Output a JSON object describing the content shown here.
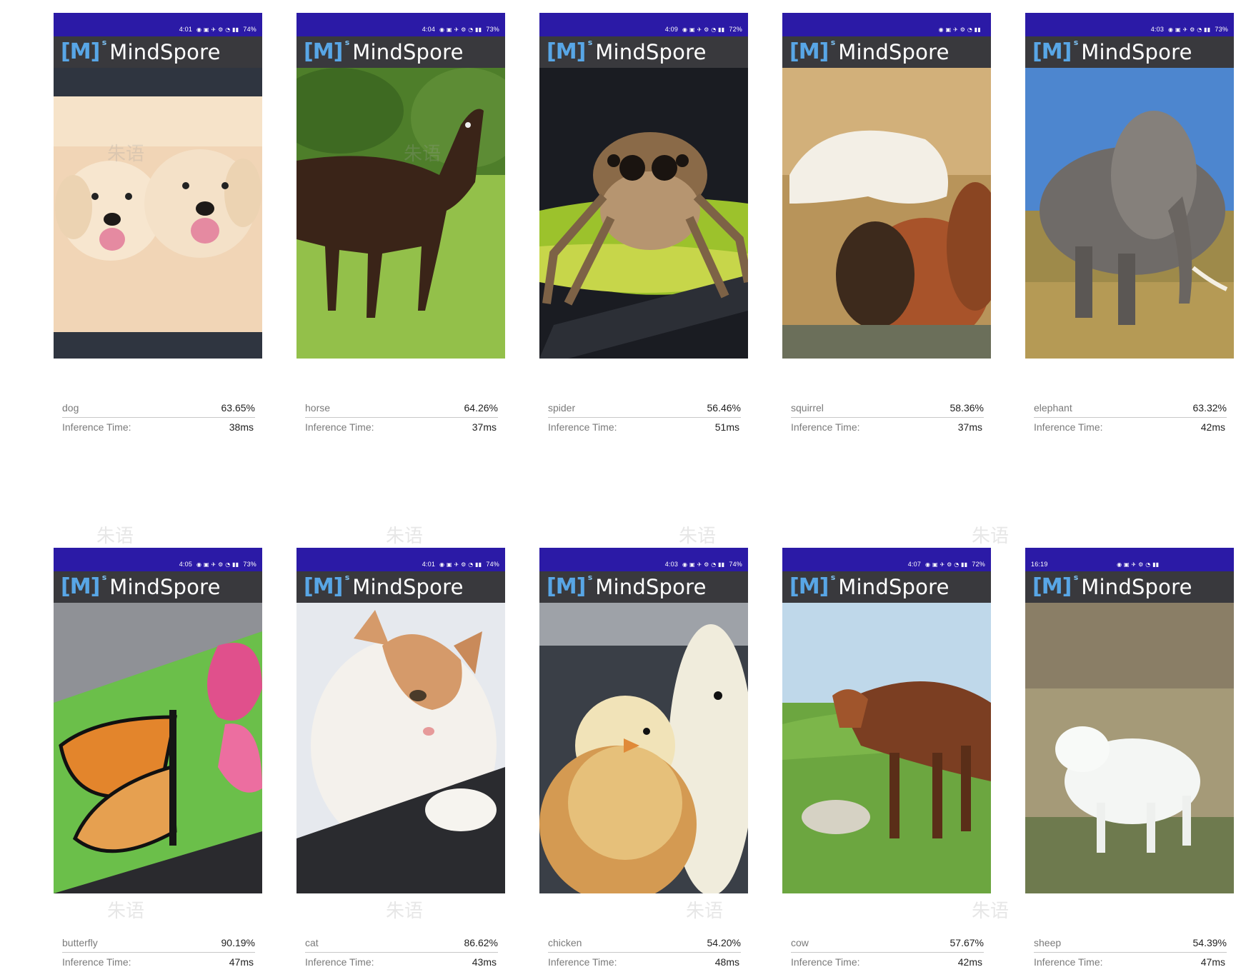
{
  "app": {
    "brand_mark": "[M]",
    "brand_super": "s",
    "name": "MindSpore",
    "inference_label": "Inference Time:"
  },
  "watermark_text": "朱语",
  "screens": [
    {
      "time": "4:01",
      "battery": "74%",
      "label": "dog",
      "confidence": "63.65%",
      "inference_ms": "38ms",
      "subject": "dog"
    },
    {
      "time": "4:04",
      "battery": "73%",
      "label": "horse",
      "confidence": "64.26%",
      "inference_ms": "37ms",
      "subject": "horse"
    },
    {
      "time": "4:09",
      "battery": "72%",
      "label": "spider",
      "confidence": "56.46%",
      "inference_ms": "51ms",
      "subject": "spider"
    },
    {
      "time": "",
      "battery": "",
      "label": "squirrel",
      "confidence": "58.36%",
      "inference_ms": "37ms",
      "subject": "squirrel"
    },
    {
      "time": "4:03",
      "battery": "73%",
      "label": "elephant",
      "confidence": "63.32%",
      "inference_ms": "42ms",
      "subject": "elephant"
    },
    {
      "time": "4:05",
      "battery": "73%",
      "label": "butterfly",
      "confidence": "90.19%",
      "inference_ms": "47ms",
      "subject": "butterfly"
    },
    {
      "time": "4:01",
      "battery": "74%",
      "label": "cat",
      "confidence": "86.62%",
      "inference_ms": "43ms",
      "subject": "cat"
    },
    {
      "time": "4:03",
      "battery": "74%",
      "label": "chicken",
      "confidence": "54.20%",
      "inference_ms": "48ms",
      "subject": "chicken"
    },
    {
      "time": "4:07",
      "battery": "72%",
      "label": "cow",
      "confidence": "57.67%",
      "inference_ms": "42ms",
      "subject": "cow"
    },
    {
      "time": "16:19",
      "battery": "",
      "label": "sheep",
      "confidence": "54.39%",
      "inference_ms": "47ms",
      "subject": "sheep"
    }
  ],
  "colors": {
    "status_bar": "#2b1aa6",
    "app_bar": "#3c3c40",
    "logo_blue": "#58a6e6"
  }
}
